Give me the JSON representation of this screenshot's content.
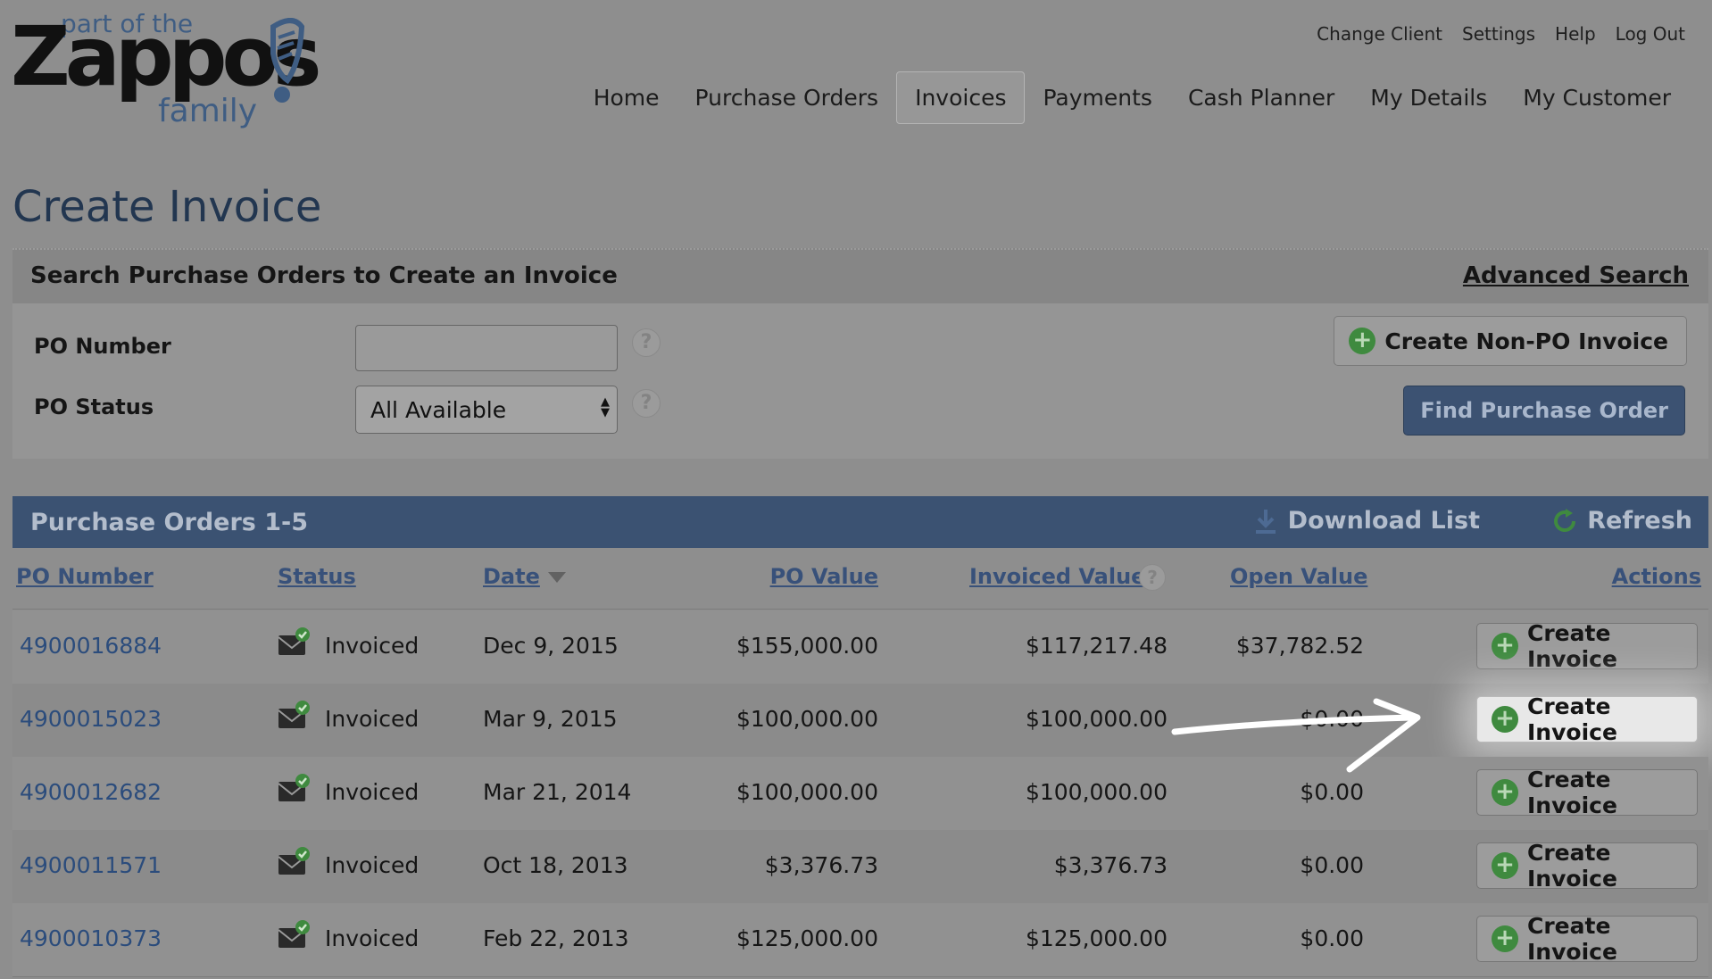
{
  "logo": {
    "top": "part of the",
    "brand": "Zappos",
    "bottom": "family"
  },
  "util_links": [
    "Change Client",
    "Settings",
    "Help",
    "Log Out"
  ],
  "nav": [
    "Home",
    "Purchase Orders",
    "Invoices",
    "Payments",
    "Cash Planner",
    "My Details",
    "My Customer"
  ],
  "active_nav": "Invoices",
  "page_title": "Create Invoice",
  "search": {
    "title": "Search Purchase Orders to Create an Invoice",
    "advanced": "Advanced Search",
    "po_number_label": "PO Number",
    "po_number_value": "",
    "po_status_label": "PO Status",
    "po_status_value": "All Available",
    "help_glyph": "?",
    "non_po_button": "Create Non-PO Invoice",
    "find_button": "Find Purchase Order"
  },
  "results": {
    "title": "Purchase Orders 1-5",
    "download": "Download List",
    "refresh": "Refresh",
    "columns": {
      "po_number": "PO Number",
      "status": "Status",
      "date": "Date",
      "po_value": "PO Value",
      "invoiced_value": "Invoiced Value",
      "open_value": "Open Value",
      "actions": "Actions"
    },
    "rows": [
      {
        "po": "4900016884",
        "status": "Invoiced",
        "date": "Dec 9, 2015",
        "po_value": "$155,000.00",
        "invoiced": "$117,217.48",
        "open": "$37,782.52",
        "action": "Create Invoice"
      },
      {
        "po": "4900015023",
        "status": "Invoiced",
        "date": "Mar 9, 2015",
        "po_value": "$100,000.00",
        "invoiced": "$100,000.00",
        "open": "$0.00",
        "action": "Create Invoice"
      },
      {
        "po": "4900012682",
        "status": "Invoiced",
        "date": "Mar 21, 2014",
        "po_value": "$100,000.00",
        "invoiced": "$100,000.00",
        "open": "$0.00",
        "action": "Create Invoice"
      },
      {
        "po": "4900011571",
        "status": "Invoiced",
        "date": "Oct 18, 2013",
        "po_value": "$3,376.73",
        "invoiced": "$3,376.73",
        "open": "$0.00",
        "action": "Create Invoice"
      },
      {
        "po": "4900010373",
        "status": "Invoiced",
        "date": "Feb 22, 2013",
        "po_value": "$125,000.00",
        "invoiced": "$125,000.00",
        "open": "$0.00",
        "action": "Create Invoice"
      }
    ]
  },
  "icons": {
    "status": "envelope-check-icon",
    "plus": "plus-circle-icon",
    "download": "download-icon",
    "refresh": "refresh-icon",
    "sort": "sort-desc-icon"
  },
  "colors": {
    "overlay_background": "#8e8e8e",
    "title_bar": "#3b5272",
    "link": "#2b4c7c",
    "plus_green": "#3f8a3f"
  }
}
